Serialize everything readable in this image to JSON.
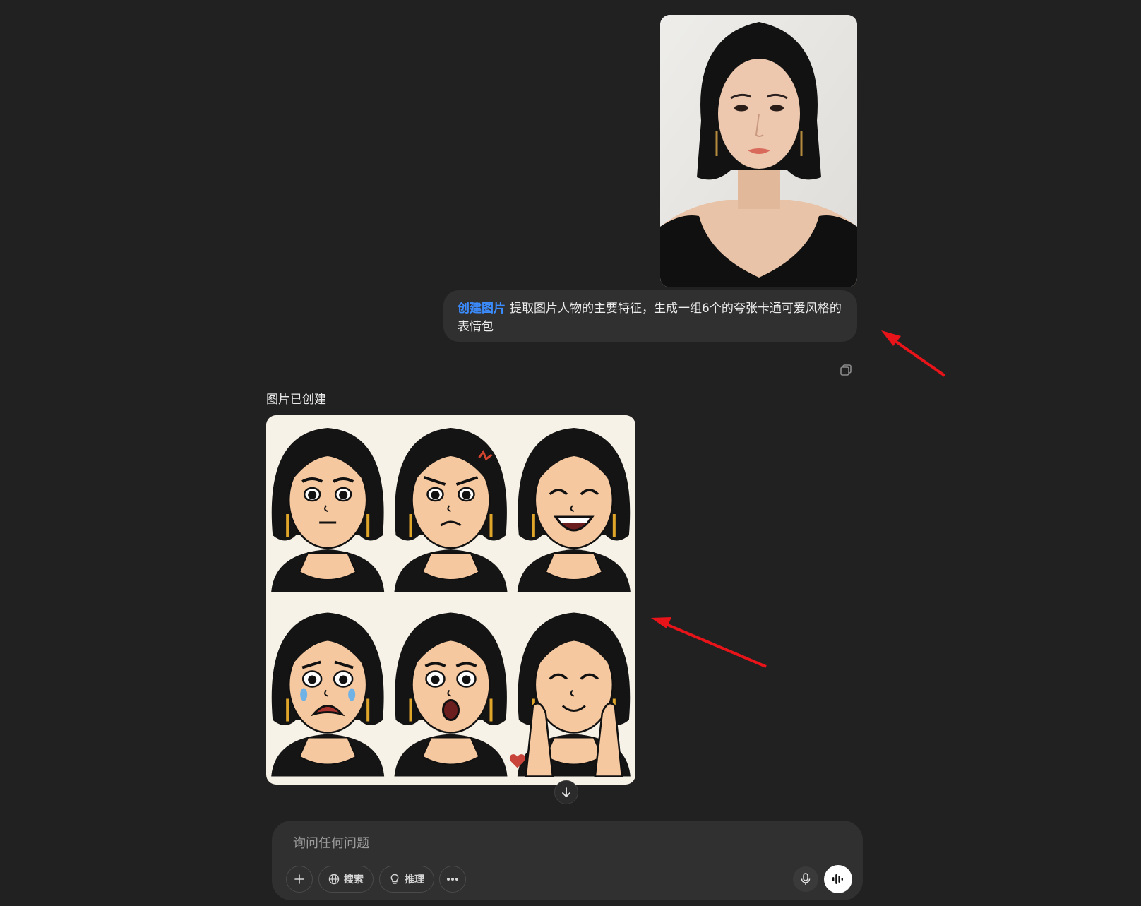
{
  "conversation": {
    "user_message": {
      "tag": "创建图片",
      "text": "提取图片人物的主要特征，生成一组6个的夸张卡通可爱风格的表情包"
    },
    "assistant": {
      "status": "图片已创建"
    }
  },
  "composer": {
    "placeholder": "询问任何问题",
    "search_label": "搜索",
    "reason_label": "推理"
  },
  "colors": {
    "background": "#212121",
    "bubble": "#303030",
    "tag_accent": "#3b8cff",
    "annotation_arrow": "#e8141a"
  }
}
